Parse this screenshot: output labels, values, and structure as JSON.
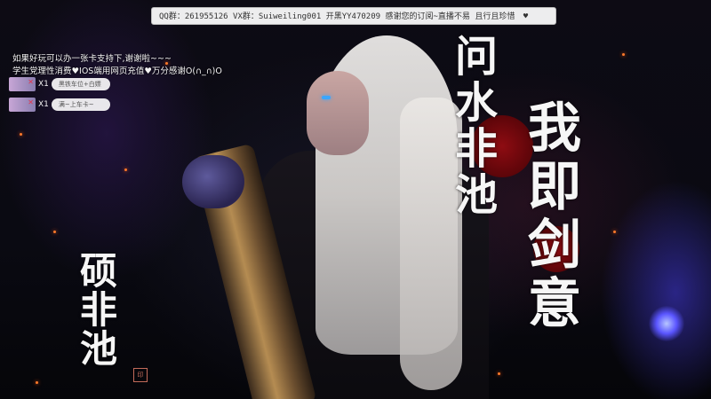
{
  "banner": {
    "text": "QQ群：261955126 VX群：Suiweiling001 开黑YY470209 感谢您的订阅~直播不易 且行且珍惜",
    "heart": "♥"
  },
  "donate": {
    "line1": "如果好玩可以办一张卡支持下,谢谢啦~~~",
    "line2": "学生党理性消费♥IOS端用网页充值♥万分感谢O(∩_∩)O"
  },
  "cards": [
    {
      "mult": "X1",
      "label": "黑铁车位+白嫖",
      "mark": "✕"
    },
    {
      "mark": "✕",
      "mult": "X1",
      "label": "满~上车卡~"
    }
  ],
  "calligraphy": {
    "col1": [
      "问",
      "水",
      "非",
      "池"
    ],
    "col2": [
      "我",
      "即",
      "剑",
      "意"
    ],
    "col3": [
      "硕",
      "非",
      "池"
    ],
    "seal": "印"
  },
  "colors": {
    "banner_bg": "#ffffff",
    "calligraphy": "#f6f6f6",
    "accent_red": "#8e0c12",
    "glow_blue": "#5a55ff"
  }
}
